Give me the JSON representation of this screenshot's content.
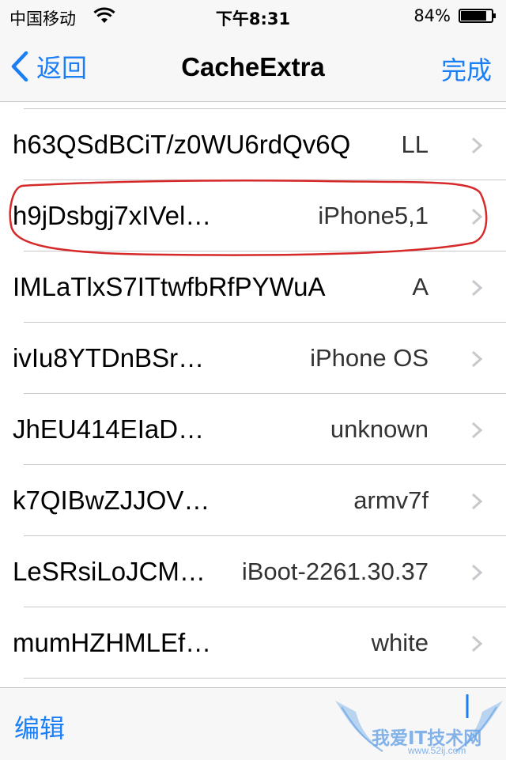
{
  "status_bar": {
    "carrier": "中国移动",
    "time": "下午8:31",
    "battery_percent": "84%",
    "battery_level": 0.84,
    "wifi_icon": "wifi-icon"
  },
  "nav": {
    "back_label": "返回",
    "title": "CacheExtra",
    "done_label": "完成"
  },
  "rows": [
    {
      "key": "h63QSdBCiT/z0WU6rdQv6Q",
      "value": "LL"
    },
    {
      "key": "h9jDsbgj7xIVel…",
      "value": "iPhone5,1"
    },
    {
      "key": "IMLaTlxS7ITtwfbRfPYWuA",
      "value": "A"
    },
    {
      "key": "ivIu8YTDnBSr…",
      "value": "iPhone OS"
    },
    {
      "key": "JhEU414EIaD…",
      "value": "unknown"
    },
    {
      "key": "k7QIBwZJJOV…",
      "value": "armv7f"
    },
    {
      "key": "LeSRsiLoJCM…",
      "value": "iBoot-2261.30.37"
    },
    {
      "key": "mumHZHMLEf…",
      "value": "white"
    }
  ],
  "toolbar": {
    "edit_label": "编辑"
  },
  "watermark": {
    "text": "我爱IT技术网",
    "url": "www.52ij.com"
  },
  "colors": {
    "accent": "#1a7ef5",
    "highlight_annotation": "#d62a2a",
    "separator": "#c8c7cc"
  }
}
